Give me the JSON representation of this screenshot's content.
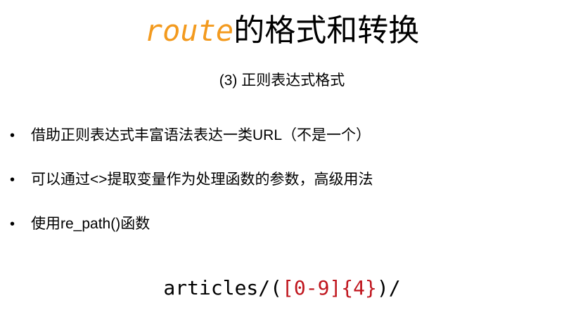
{
  "title": {
    "code": "route",
    "rest": "的格式和转换"
  },
  "subtitle": "(3) 正则表达式格式",
  "bullets": [
    {
      "marker": "•",
      "text": "借助正则表达式丰富语法表达一类URL（不是一个）"
    },
    {
      "marker": "•",
      "text": "可以通过<>提取变量作为处理函数的参数，高级用法"
    },
    {
      "marker": "•",
      "text": "使用re_path()函数"
    }
  ],
  "code_example": {
    "prefix": "articles/(",
    "pattern": "[0-9]{4}",
    "suffix": ")/"
  },
  "colors": {
    "title_code": "#f39a1e",
    "code_highlight": "#c0161e",
    "text": "#000000",
    "background": "#ffffff"
  }
}
